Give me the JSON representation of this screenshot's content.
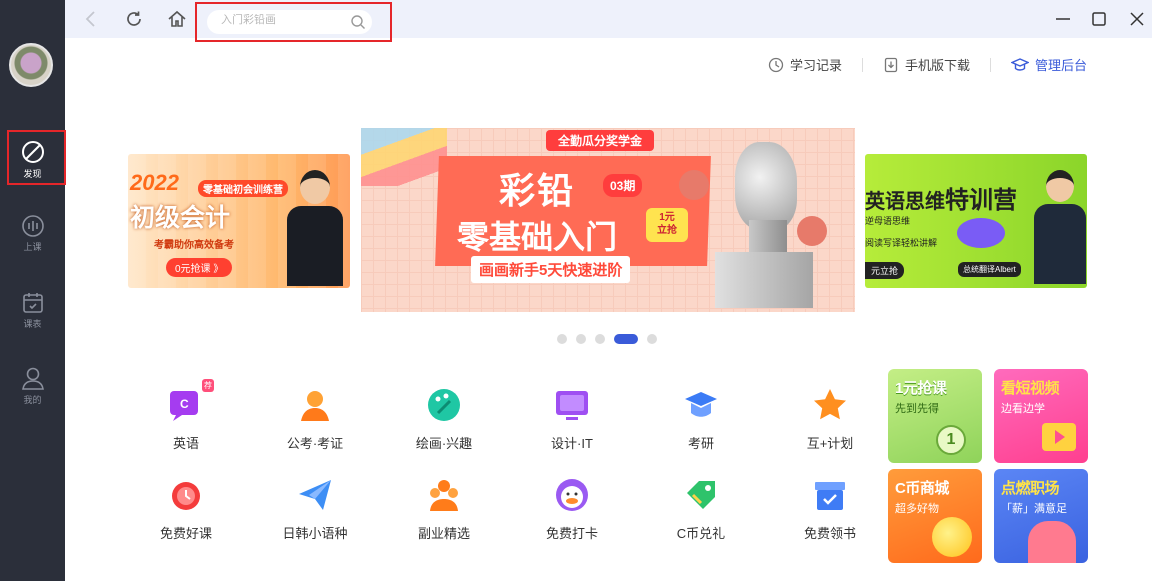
{
  "sidebar": {
    "items": [
      {
        "label": "发现",
        "icon": "compass-icon"
      },
      {
        "label": "上课",
        "icon": "live-class-icon"
      },
      {
        "label": "课表",
        "icon": "calendar-icon"
      },
      {
        "label": "我的",
        "icon": "user-icon"
      }
    ]
  },
  "titlebar": {
    "search_placeholder": "入门彩铅画",
    "icons": [
      "back-arrow-icon",
      "refresh-icon",
      "home-icon",
      "minimize-icon",
      "maximize-icon",
      "close-icon"
    ]
  },
  "top_links": {
    "history": "学习记录",
    "mobile": "手机版下载",
    "admin": "管理后台"
  },
  "banner": {
    "left": {
      "tag": "零基础初会训练营",
      "line1": "2022",
      "line2": "初级会计",
      "line3": "考霸助你高效备考",
      "cta": "0元抢课 》"
    },
    "main": {
      "top_tag": "全勤瓜分奖学金",
      "title1": "彩铅",
      "issue": "03期",
      "title2": "零基础入门",
      "price1": "1元",
      "price2": "立抢",
      "subtitle": "画画新手5天快速进阶"
    },
    "right": {
      "title1": "英语思维",
      "title2": "特训营",
      "line1": "逆母语思维",
      "line2": "阅读写译轻松讲解",
      "cta": "元立抢",
      "teacher": "总统翻译Albert"
    },
    "dots_count": 5,
    "active_dot": 4
  },
  "categories": [
    {
      "label": "英语",
      "icon": "english-chat-icon",
      "color": "#a53cf0",
      "badge": "荐"
    },
    {
      "label": "公考·考证",
      "icon": "exam-person-icon",
      "color": "#ff8a1d"
    },
    {
      "label": "绘画·兴趣",
      "icon": "palette-icon",
      "color": "#1fc7a4"
    },
    {
      "label": "设计·IT",
      "icon": "monitor-icon",
      "color": "#9f4ff2"
    },
    {
      "label": "考研",
      "icon": "graduation-cap-icon",
      "color": "#3b7bf5"
    },
    {
      "label": "互+计划",
      "icon": "star-icon",
      "color": "#ff8f1f"
    },
    {
      "label": "免费好课",
      "icon": "alarm-clock-icon",
      "color": "#f43c3c"
    },
    {
      "label": "日韩小语种",
      "icon": "paper-plane-icon",
      "color": "#3d8ef5"
    },
    {
      "label": "副业精选",
      "icon": "people-icon",
      "color": "#ff7c1a"
    },
    {
      "label": "免费打卡",
      "icon": "duck-icon",
      "color": "#9a5af2"
    },
    {
      "label": "C币兑礼",
      "icon": "gift-tag-icon",
      "color": "#2ec36b"
    },
    {
      "label": "免费领书",
      "icon": "book-box-icon",
      "color": "#3f7cf5"
    }
  ],
  "promos": [
    {
      "title": "1元抢课",
      "subtitle": "先到先得",
      "bg": "#a8e06d"
    },
    {
      "title": "看短视频",
      "subtitle": "边看边学",
      "bg": "#ff4fa3"
    },
    {
      "title": "C币商城",
      "subtitle": "超多好物",
      "bg": "#ff8a2c"
    },
    {
      "title": "点燃职场",
      "subtitle": "「薪」满意足",
      "bg": "#4a78f0"
    }
  ]
}
